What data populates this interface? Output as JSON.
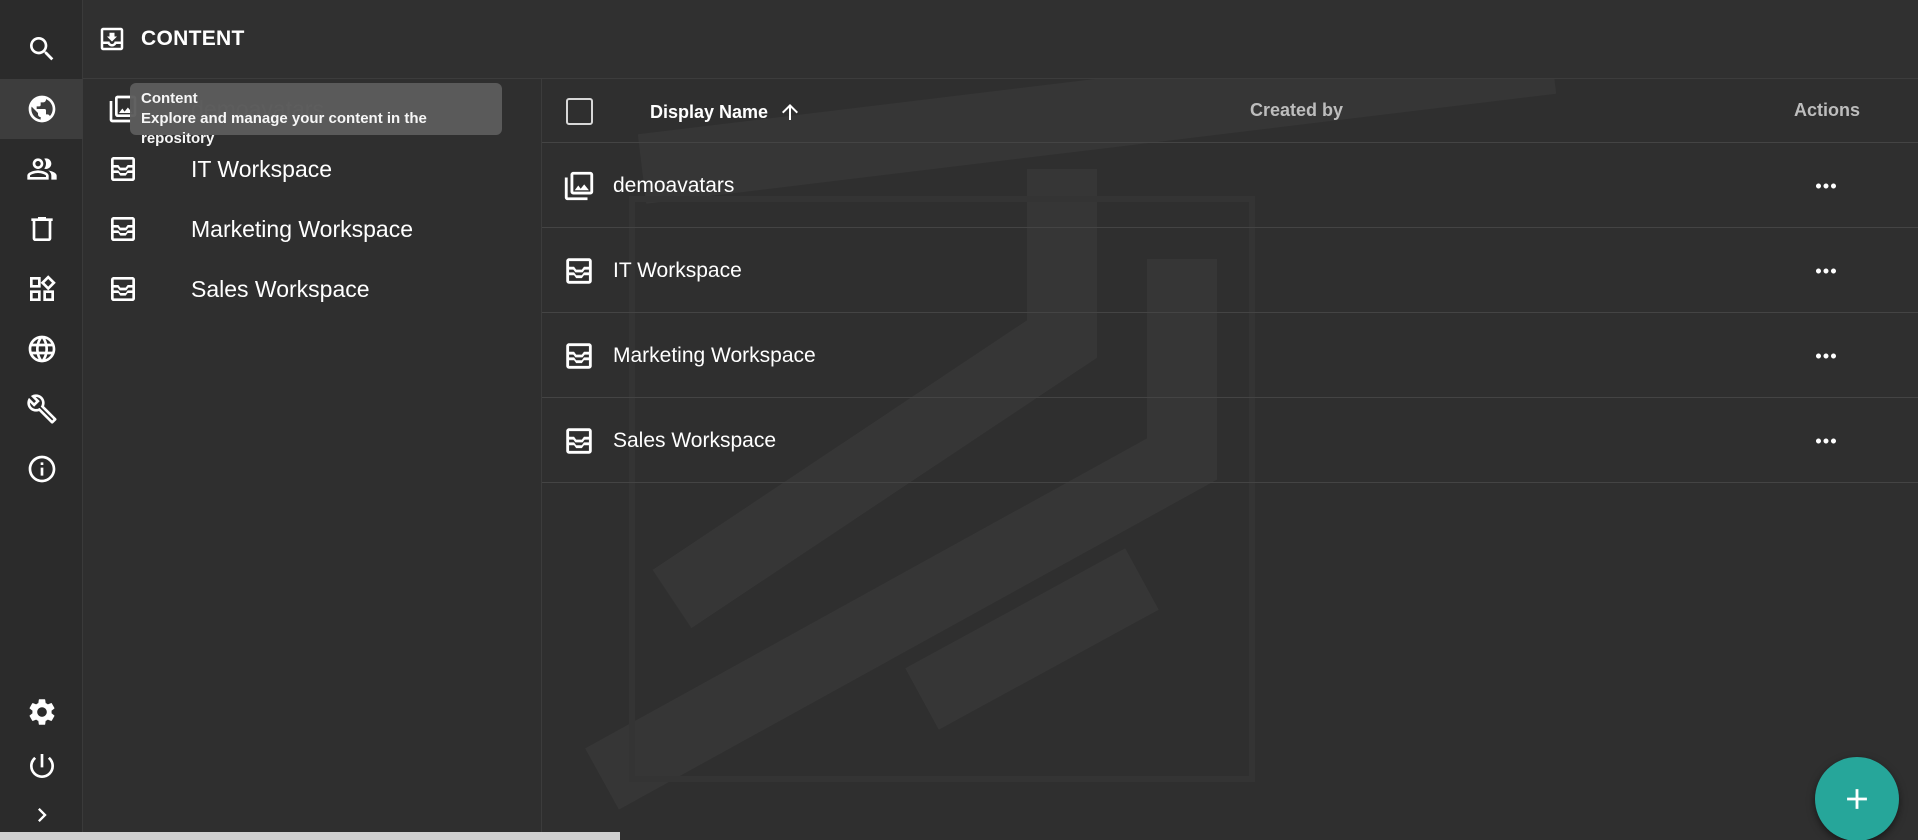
{
  "header": {
    "title": "CONTENT",
    "icon": "inbox-tray-icon"
  },
  "rail": {
    "items": [
      {
        "name": "search",
        "icon": "search-icon"
      },
      {
        "name": "content",
        "icon": "globe-icon",
        "active": true
      },
      {
        "name": "users",
        "icon": "people-icon"
      },
      {
        "name": "trash",
        "icon": "trash-icon"
      },
      {
        "name": "apps",
        "icon": "widgets-icon"
      },
      {
        "name": "localization",
        "icon": "language-icon"
      },
      {
        "name": "setup",
        "icon": "wrench-icon"
      },
      {
        "name": "about",
        "icon": "info-icon"
      }
    ],
    "bottom": [
      {
        "name": "settings",
        "icon": "gear-icon"
      },
      {
        "name": "logout",
        "icon": "power-icon"
      },
      {
        "name": "expand",
        "icon": "chevron-right-icon"
      }
    ]
  },
  "tooltip": {
    "title": "Content",
    "text": "Explore and manage your content in the repository"
  },
  "tree": {
    "items": [
      {
        "label": "demoavatars",
        "icon": "image-library-icon"
      },
      {
        "label": "IT Workspace",
        "icon": "inbox-tray-icon"
      },
      {
        "label": "Marketing Workspace",
        "icon": "inbox-tray-icon"
      },
      {
        "label": "Sales Workspace",
        "icon": "inbox-tray-icon"
      }
    ]
  },
  "grid": {
    "columns": {
      "display_name": "Display Name",
      "created_by": "Created by",
      "actions": "Actions"
    },
    "sort": {
      "column": "display_name",
      "direction": "ascending",
      "icon": "arrow-up-icon"
    },
    "rows": [
      {
        "name": "demoavatars",
        "icon": "image-library-icon",
        "created_by": ""
      },
      {
        "name": "IT Workspace",
        "icon": "inbox-tray-icon",
        "created_by": ""
      },
      {
        "name": "Marketing Workspace",
        "icon": "inbox-tray-icon",
        "created_by": ""
      },
      {
        "name": "Sales Workspace",
        "icon": "inbox-tray-icon",
        "created_by": ""
      }
    ]
  },
  "fab": {
    "icon": "plus-icon",
    "color": "#26a69a"
  },
  "colors": {
    "background": "#2f2f2f",
    "rail": "#2b2b2b",
    "tooltip": "#5c5c5c",
    "accent": "#26a69a"
  }
}
